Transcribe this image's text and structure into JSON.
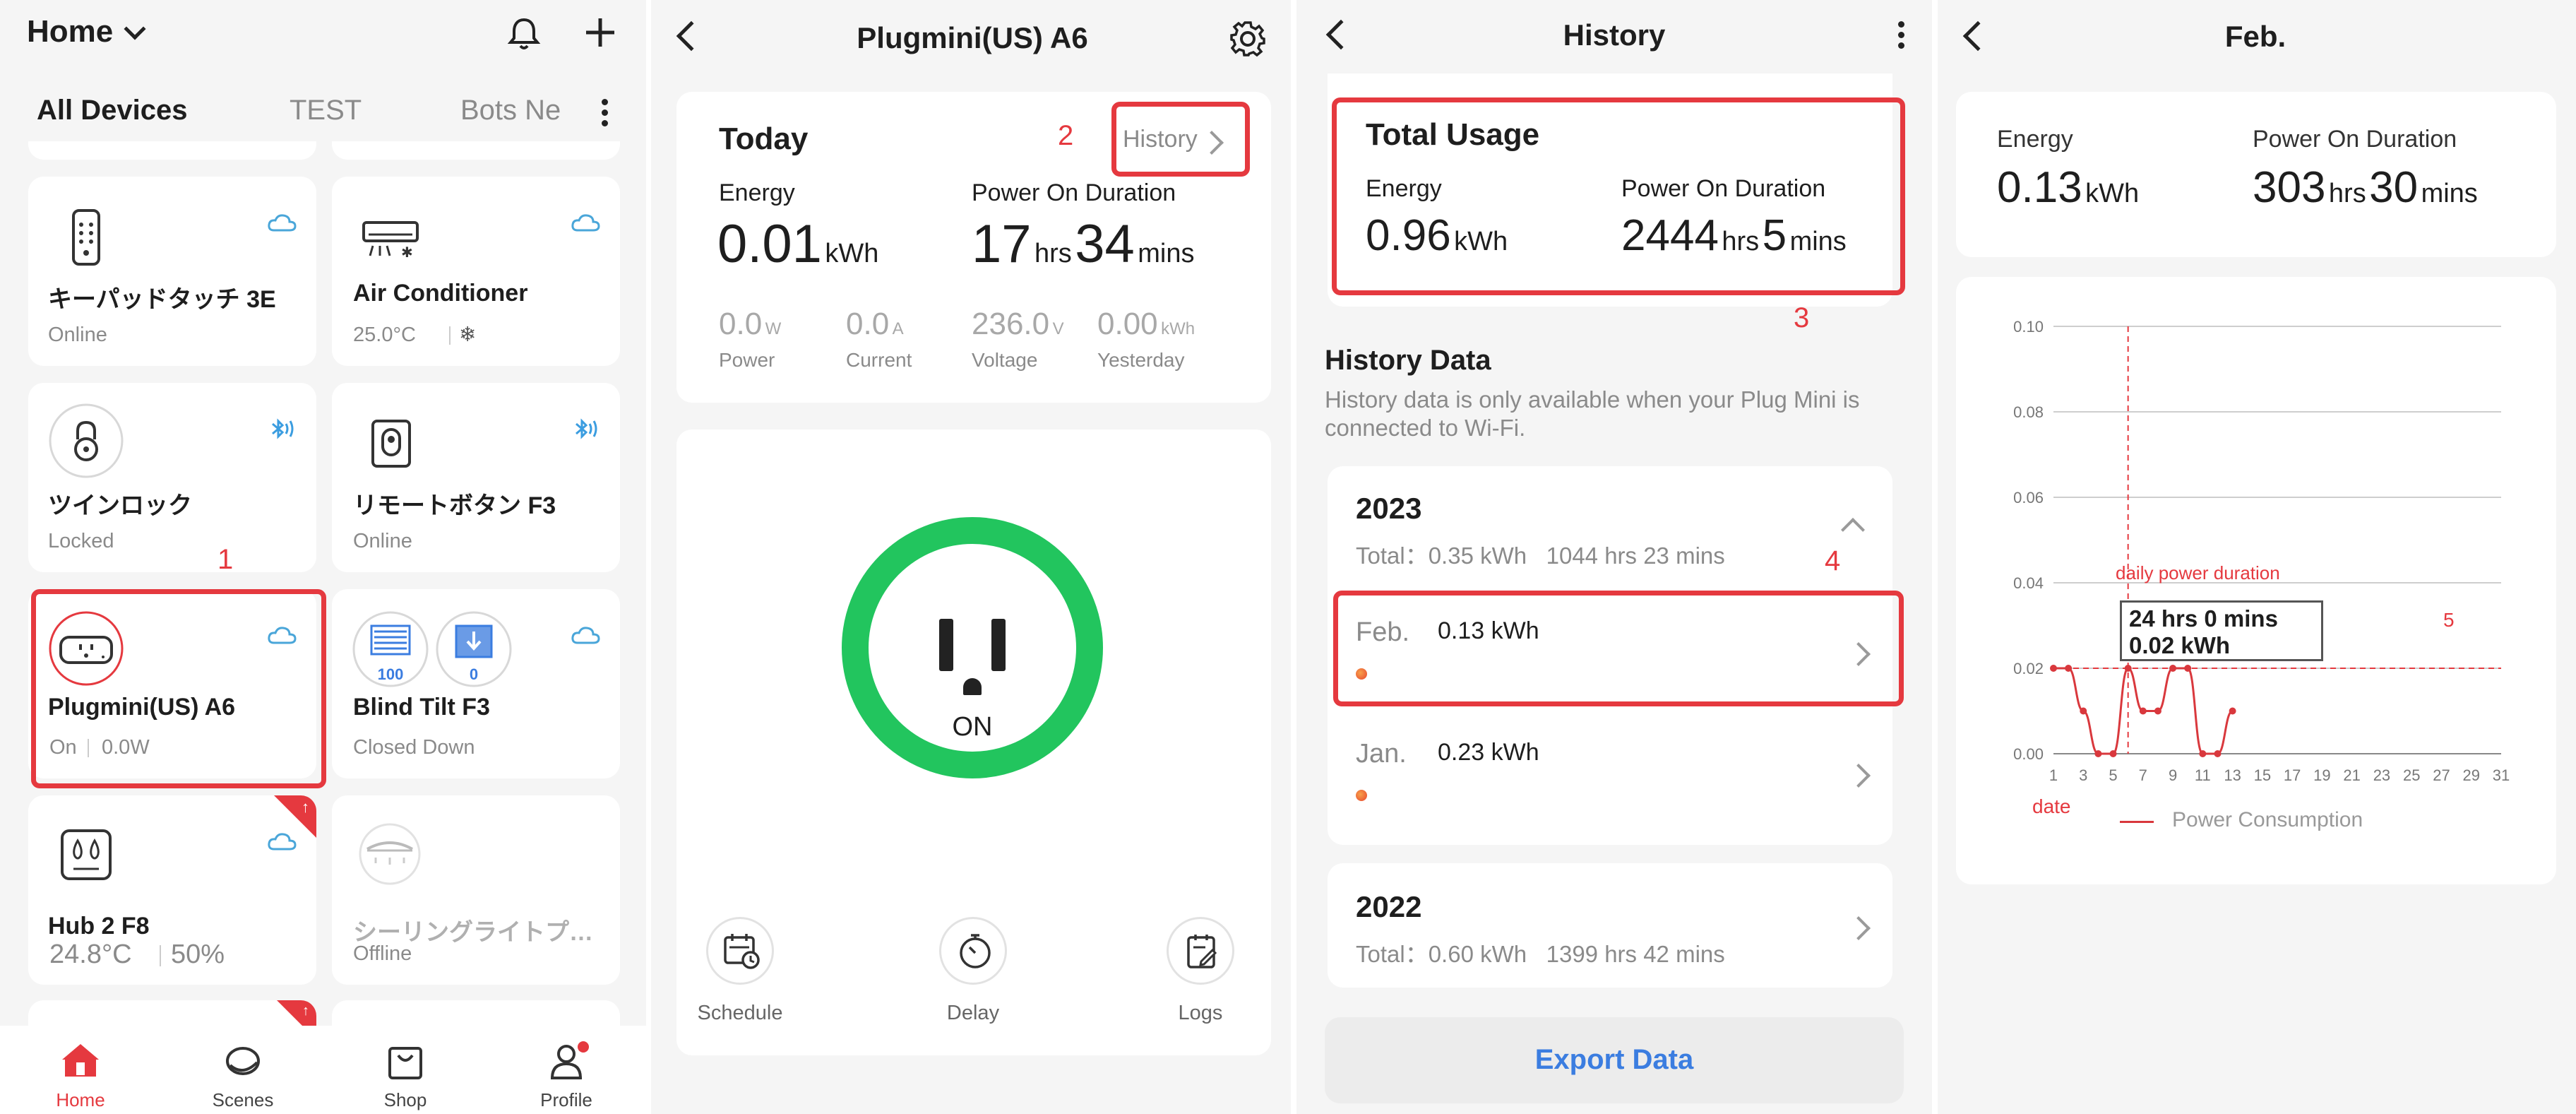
{
  "panel1": {
    "home_title": "Home",
    "tabs": [
      "All Devices",
      "TEST",
      "Bots Ne"
    ],
    "devices": [
      {
        "name": "キーパッドタッチ 3E",
        "status": "Online"
      },
      {
        "name": "Air Conditioner",
        "status": "25.0°C",
        "status2": "❄"
      },
      {
        "name": "ツインロック",
        "status": "Locked"
      },
      {
        "name": "リモートボタン F3",
        "status": "Online"
      },
      {
        "name": "Plugmini(US) A6",
        "status": "On",
        "status2": "0.0W"
      },
      {
        "name": "Blind Tilt F3",
        "status": "Closed Down",
        "badge1": "100",
        "badge2": "0"
      },
      {
        "name": "Hub 2 F8",
        "status": "24.8°C",
        "status2": "50%"
      },
      {
        "name": "シーリングライトプ…",
        "status": "Offline"
      }
    ],
    "annotation": "1",
    "nav": [
      {
        "label": "Home"
      },
      {
        "label": "Scenes"
      },
      {
        "label": "Shop"
      },
      {
        "label": "Profile"
      }
    ],
    "colors": {
      "accent": "#e5393f",
      "cloud": "#4aa6d9",
      "bluetooth": "#3b9de0"
    }
  },
  "panel2": {
    "title": "Plugmini(US) A6",
    "today_label": "Today",
    "annotation": "2",
    "history_link": "History",
    "energy_label": "Energy",
    "energy_value": "0.01",
    "energy_unit": "kWh",
    "duration_label": "Power On Duration",
    "duration_hrs": "17",
    "hrs_unit": "hrs",
    "duration_mins": "34",
    "mins_unit": "mins",
    "metrics": [
      {
        "value": "0.0",
        "unit": "W",
        "label": "Power"
      },
      {
        "value": "0.0",
        "unit": "A",
        "label": "Current"
      },
      {
        "value": "236.0",
        "unit": "V",
        "label": "Voltage"
      },
      {
        "value": "0.00",
        "unit": "kWh",
        "label": "Yesterday"
      }
    ],
    "plug_state": "ON",
    "actions": [
      {
        "label": "Schedule"
      },
      {
        "label": "Delay"
      },
      {
        "label": "Logs"
      }
    ],
    "colors": {
      "ring": "#22c55e"
    }
  },
  "panel3": {
    "title": "History",
    "total_title": "Total Usage",
    "energy_label": "Energy",
    "energy_value": "0.96",
    "energy_unit": "kWh",
    "duration_label": "Power On Duration",
    "duration_hrs": "2444",
    "hrs_unit": "hrs",
    "duration_mins": "5",
    "mins_unit": "mins",
    "annotation3": "3",
    "history_data_title": "History Data",
    "history_note": "History data is only available when your Plug Mini is connected to Wi-Fi.",
    "year1": "2023",
    "year1_total": "Total：0.35 kWh   1044 hrs 23 mins",
    "annotation4": "4",
    "months": [
      {
        "month": "Feb.",
        "value": "0.13 kWh"
      },
      {
        "month": "Jan.",
        "value": "0.23 kWh"
      }
    ],
    "year2": "2022",
    "year2_total": "Total：0.60 kWh   1399 hrs 42 mins",
    "export_label": "Export Data",
    "colors": {
      "export": "#3b7de0",
      "dot": "#f07a2b"
    }
  },
  "panel4": {
    "title": "Feb.",
    "energy_label": "Energy",
    "energy_value": "0.13",
    "energy_unit": "kWh",
    "duration_label": "Power On Duration",
    "duration_hrs": "303",
    "hrs_unit": "hrs",
    "duration_mins": "30",
    "mins_unit": "mins",
    "tooltip_line1": "24 hrs 0 mins",
    "tooltip_line2": "0.02 kWh",
    "annotation_daily": "daily power duration",
    "annotation_date": "date",
    "annotation5": "5"
  },
  "chart_data": {
    "type": "line",
    "x": [
      1,
      2,
      3,
      4,
      5,
      6,
      7,
      8,
      9,
      10,
      11,
      12,
      13
    ],
    "series": [
      {
        "name": "Power Consumption",
        "values": [
          0.02,
          0.02,
          0.01,
          0.0,
          0.0,
          0.02,
          0.01,
          0.01,
          0.02,
          0.02,
          0.0,
          0.0,
          0.01
        ]
      }
    ],
    "xticks": [
      "1",
      "3",
      "5",
      "7",
      "9",
      "11",
      "13",
      "15",
      "17",
      "19",
      "21",
      "23",
      "25",
      "27",
      "29",
      "31"
    ],
    "yticks": [
      "0.00",
      "0.02",
      "0.04",
      "0.06",
      "0.08",
      "0.10"
    ],
    "xlim": [
      1,
      31
    ],
    "ylim": [
      0,
      0.1
    ],
    "grid": true,
    "legend": "bottom",
    "highlight_x": 6,
    "highlight_y": 0.02,
    "color": "#d9383d"
  }
}
